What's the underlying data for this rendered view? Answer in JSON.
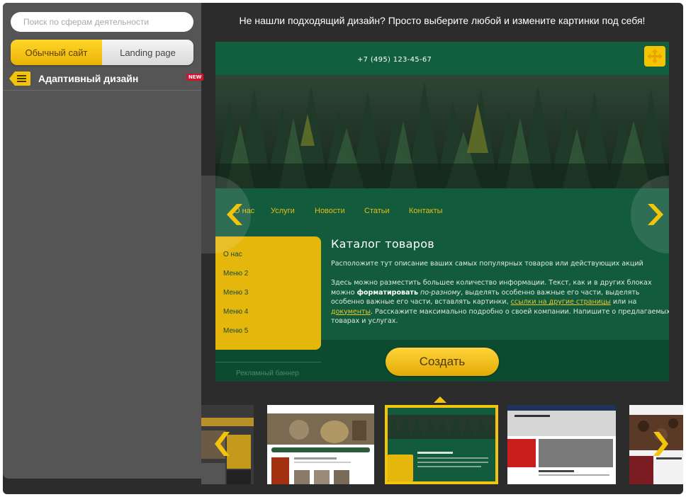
{
  "search": {
    "placeholder": "Поиск по сферам деятельности"
  },
  "type_toggle": {
    "regular": "Обычный сайт",
    "landing": "Landing page",
    "selected": "Обычный сайт"
  },
  "adaptive": {
    "label": "Адаптивный дизайн",
    "badge": "NEW",
    "icon": "menu-lines-icon"
  },
  "headline": "Не нашли подходящий дизайн? Просто выберите любой и измените картинки под себя!",
  "preview": {
    "phone": "+7 (495) 123-45-67",
    "nav": [
      "О нас",
      "Услуги",
      "Новости",
      "Статьи",
      "Контакты"
    ],
    "side_menu": [
      "О нас",
      "Меню 2",
      "Меню 3",
      "Меню 4",
      "Меню 5"
    ],
    "banner": "Рекламный баннер",
    "title": "Каталог товаров",
    "lead": "Расположите тут описание ваших самых популярных товаров или действующих акций",
    "body": {
      "t1": "Здесь можно разместить большее количество информации. Текст, как и в других блоках можно ",
      "bold": "форматировать",
      "t2": " ",
      "italic": "по-разному",
      "t3": ", выделять особенно важные его части, выделять особенно важные его части, вставлять картинки, ",
      "link1": "ссылки на другие страницы",
      "t4": " или на ",
      "link2": "документы",
      "t5": ". Расскажите максимально подробно о своей компании. Напишите о предлагаемых товарах и услугах."
    }
  },
  "create_button": "Создать",
  "thumbnails": [
    {
      "name": "thumb-restaurant",
      "selected": false
    },
    {
      "name": "thumb-tea",
      "selected": false,
      "label": "Каталог товаров"
    },
    {
      "name": "thumb-forest",
      "selected": true,
      "label": "Каталог товаров"
    },
    {
      "name": "thumb-stone-wall",
      "selected": false,
      "label": "Каталог товаров"
    },
    {
      "name": "thumb-coffee",
      "selected": false,
      "label": "Каталог товаров"
    }
  ],
  "colors": {
    "accent": "#f2c40c",
    "preview_green": "#135b3d",
    "sidebar": "#555555",
    "frame": "#2c2c2c",
    "badge": "#d4122d"
  }
}
